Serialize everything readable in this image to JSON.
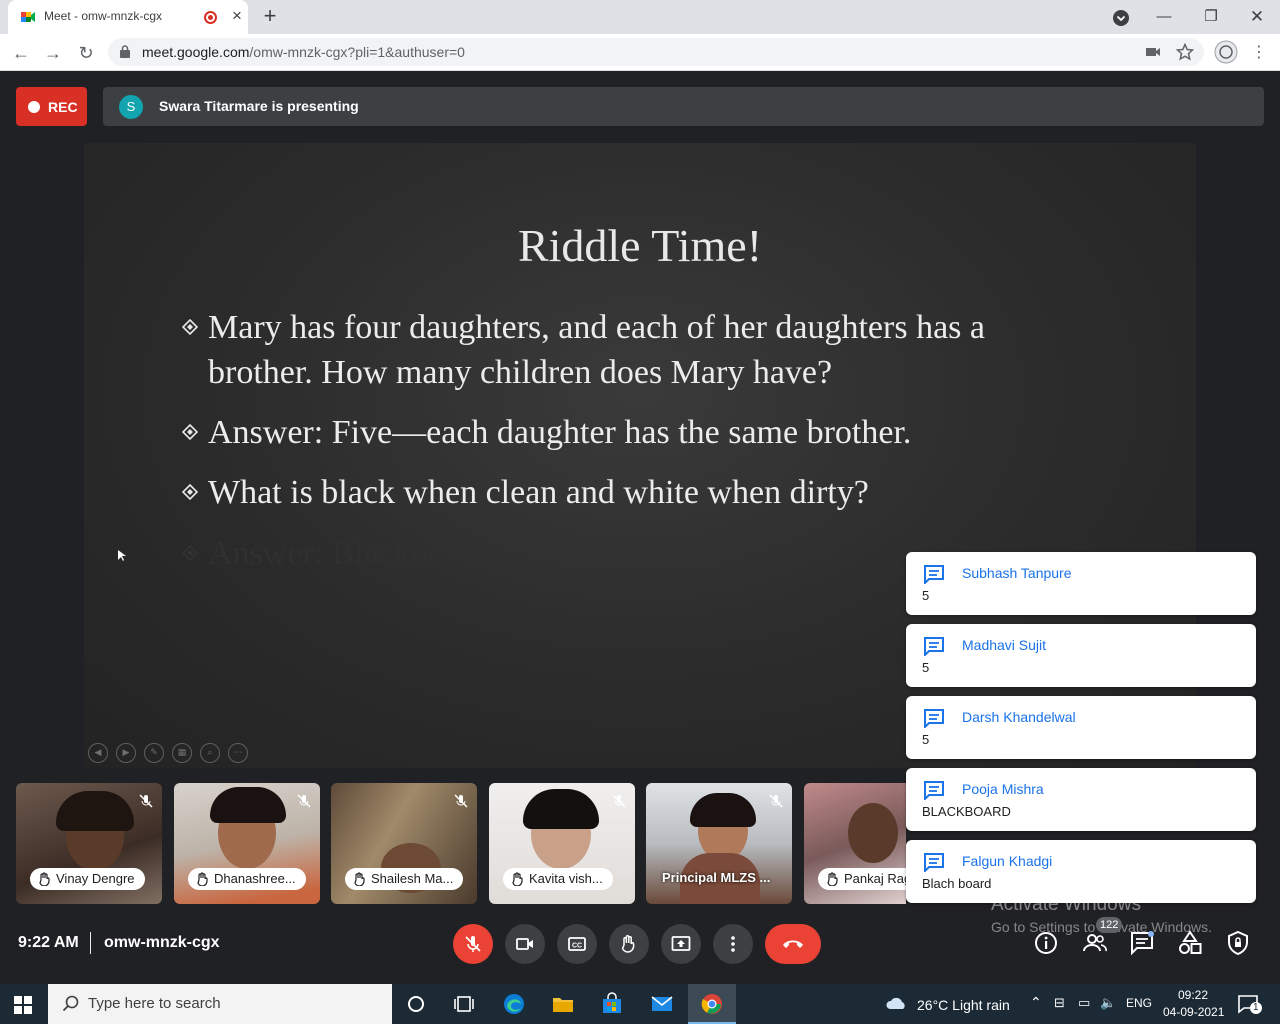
{
  "browser": {
    "tab_title": "Meet - omw-mnzk-cgx",
    "new_tab_symbol": "+",
    "url_host": "meet.google.com",
    "url_path": "/omw-mnzk-cgx?pli=1&authuser=0"
  },
  "meet": {
    "rec_label": "REC",
    "presenter_initial": "S",
    "presenting_text": "Swara Titarmare is presenting",
    "time": "9:22 AM",
    "meeting_code": "omw-mnzk-cgx",
    "participant_count": "122",
    "colors": {
      "red": "#ea4335",
      "bar": "#3c4043",
      "link_blue": "#1a73e8"
    }
  },
  "slide": {
    "title": "Riddle Time!",
    "bullets": [
      "Mary has four daughters, and each of her daughters has a brother. How many children does Mary have?",
      "Answer: Five—each daughter has the same brother.",
      "What is black when clean and white when dirty?",
      "Answer: Blackboard"
    ]
  },
  "participants": [
    {
      "name": "Vinay Dengre",
      "hand_raised": true,
      "muted": true
    },
    {
      "name": "Dhanashree...",
      "hand_raised": true,
      "muted": true
    },
    {
      "name": "Shailesh Ma...",
      "hand_raised": true,
      "muted": true
    },
    {
      "name": "Kavita vish...",
      "hand_raised": true,
      "muted": true
    },
    {
      "name": "Principal MLZS ...",
      "hand_raised": false,
      "muted": true
    },
    {
      "name": "Pankaj Rag",
      "hand_raised": true,
      "muted": false
    }
  ],
  "chat_messages": [
    {
      "sender": "Subhash Tanpure",
      "message": "5"
    },
    {
      "sender": "Madhavi Sujit",
      "message": "5"
    },
    {
      "sender": "Darsh Khandelwal",
      "message": "5"
    },
    {
      "sender": "Pooja Mishra",
      "message": "BLACKBOARD"
    },
    {
      "sender": "Falgun Khadgi",
      "message": "Blach board"
    }
  ],
  "watermark": {
    "line1": "Activate Windows",
    "line2": "Go to Settings to activate Windows."
  },
  "taskbar": {
    "search_placeholder": "Type here to search",
    "weather": "26°C  Light rain",
    "language": "ENG",
    "clock_time": "09:22",
    "clock_date": "04-09-2021",
    "notification_count": "1"
  }
}
